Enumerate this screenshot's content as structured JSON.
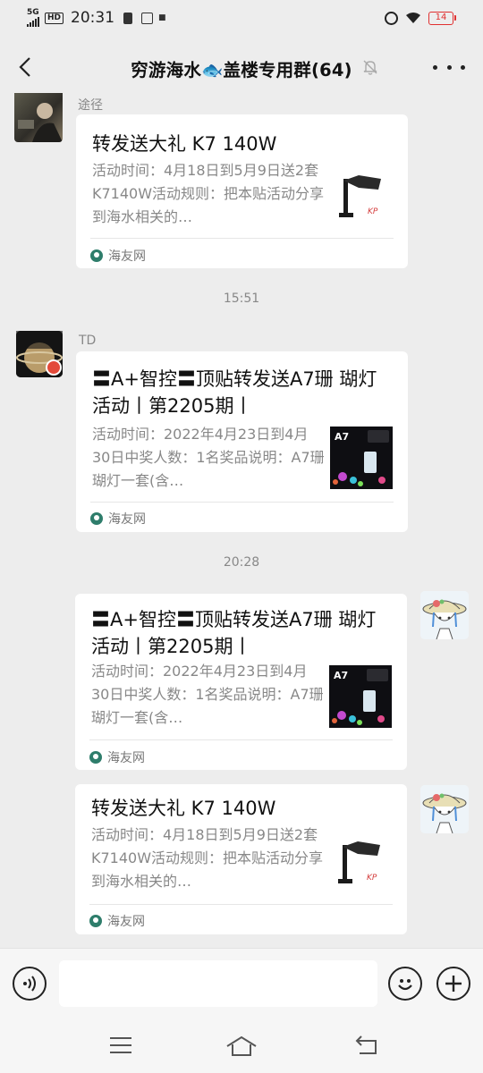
{
  "status_bar": {
    "network": "5G",
    "hd": "HD",
    "time": "20:31",
    "battery": "14",
    "battery_color": "#e03030"
  },
  "header": {
    "title": "穷游海水🐟盖楼专用群(64)",
    "back_icon": "chevron-left-icon",
    "mute_icon": "bell-off-icon",
    "more_icon": "more-dots-icon"
  },
  "messages": [
    {
      "type": "link",
      "side": "left",
      "sender": "途径",
      "title": "转发送大礼 K7 140W",
      "desc": "活动时间：4月18日到5月9日送2套K7140W活动规则：把本贴活动分享到海水相关的…",
      "source": "海友网",
      "thumb": "K7 lamp"
    },
    {
      "type": "time",
      "text": "15:51"
    },
    {
      "type": "link",
      "side": "left",
      "sender": "TD",
      "title": "〓A+智控〓顶贴转发送A7珊 瑚灯活动丨第2205期丨",
      "desc": "活动时间：2022年4月23日到4月30日中奖人数：1名奖品说明：A7珊瑚灯一套(含…",
      "source": "海友网",
      "thumb": "A7"
    },
    {
      "type": "time",
      "text": "20:28"
    },
    {
      "type": "link",
      "side": "right",
      "title": "〓A+智控〓顶贴转发送A7珊 瑚灯活动丨第2205期丨",
      "desc": "活动时间：2022年4月23日到4月30日中奖人数：1名奖品说明：A7珊瑚灯一套(含…",
      "source": "海友网",
      "thumb": "A7"
    },
    {
      "type": "link",
      "side": "right",
      "title": "转发送大礼 K7 140W",
      "desc": "活动时间：4月18日到5月9日送2套K7140W活动规则：把本贴活动分享到海水相关的…",
      "source": "海友网",
      "thumb": "K7 lamp"
    }
  ],
  "input_bar": {
    "voice_icon": "voice-icon",
    "emoji_icon": "emoji-icon",
    "plus_icon": "plus-icon",
    "placeholder": ""
  },
  "nav_bar": {
    "menu_icon": "menu-icon",
    "home_icon": "home-icon",
    "back_icon": "back-icon"
  }
}
